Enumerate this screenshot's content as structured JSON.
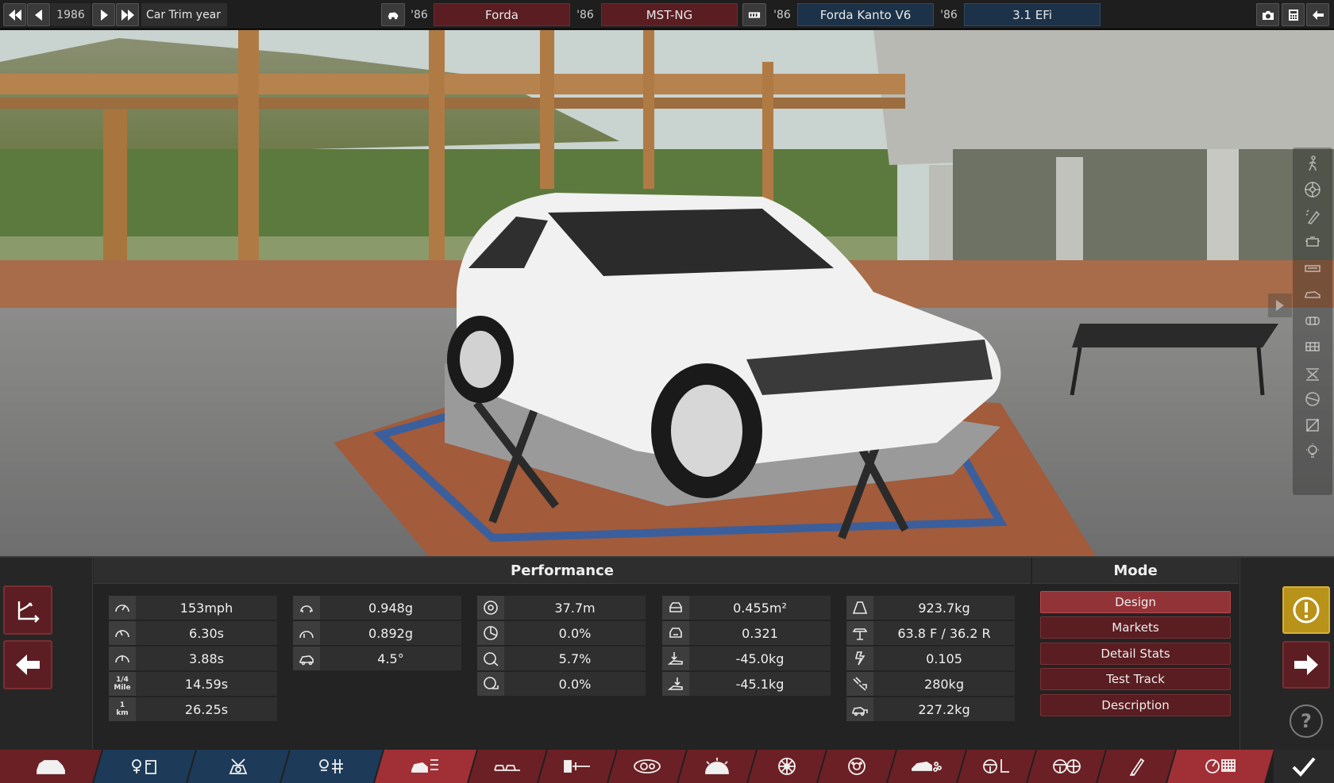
{
  "topbar": {
    "year": "1986",
    "year_label": "Car Trim year",
    "car_year_prefix": "'86",
    "car_make": "Forda",
    "model_year_prefix": "'86",
    "model_name": "MST-NG",
    "engine_year_prefix": "'86",
    "engine_name": "Forda Kanto V6",
    "variant_year_prefix": "'86",
    "variant_name": "3.1 EFi"
  },
  "performance": {
    "title": "Performance",
    "columns": [
      [
        {
          "icon": "top-speed-icon",
          "value": "153mph"
        },
        {
          "icon": "acceleration-icon",
          "value": "6.30s"
        },
        {
          "icon": "quick-accel-icon",
          "value": "3.88s"
        },
        {
          "icon": "quarter-mile-icon",
          "value": "14.59s",
          "icon_text": "1/4 Mile"
        },
        {
          "icon": "km-time-icon",
          "value": "26.25s",
          "icon_text": "1 km"
        }
      ],
      [
        {
          "icon": "cornering-icon",
          "value": "0.948g"
        },
        {
          "icon": "cornering-alt-icon",
          "value": "0.892g"
        },
        {
          "icon": "body-roll-icon",
          "value": "4.5°"
        }
      ],
      [
        {
          "icon": "braking-distance-icon",
          "value": "37.7m"
        },
        {
          "icon": "brake-fade-icon",
          "value": "0.0%"
        },
        {
          "icon": "brake-wear-icon",
          "value": "5.7%"
        },
        {
          "icon": "brake-lock-icon",
          "value": "0.0%"
        }
      ],
      [
        {
          "icon": "frontal-area-icon",
          "value": "0.455m²"
        },
        {
          "icon": "drag-coefficient-icon",
          "value": "0.321"
        },
        {
          "icon": "front-downforce-icon",
          "value": "-45.0kg"
        },
        {
          "icon": "rear-downforce-icon",
          "value": "-45.1kg"
        }
      ],
      [
        {
          "icon": "weight-icon",
          "value": "923.7kg"
        },
        {
          "icon": "weight-distribution-icon",
          "value": "63.8 F / 36.2 R"
        },
        {
          "icon": "power-to-weight-icon",
          "value": "0.105"
        },
        {
          "icon": "tow-weight-icon",
          "value": "280kg"
        },
        {
          "icon": "cargo-weight-icon",
          "value": "227.2kg"
        }
      ]
    ]
  },
  "mode": {
    "title": "Mode",
    "items": [
      "Design",
      "Markets",
      "Detail Stats",
      "Test Track",
      "Description"
    ],
    "active": "Design"
  },
  "help_label": "?",
  "colors": {
    "maroon": "#5a1d22",
    "active_red": "#923338",
    "navy": "#1c3249",
    "warning_gold": "#b9921a"
  }
}
